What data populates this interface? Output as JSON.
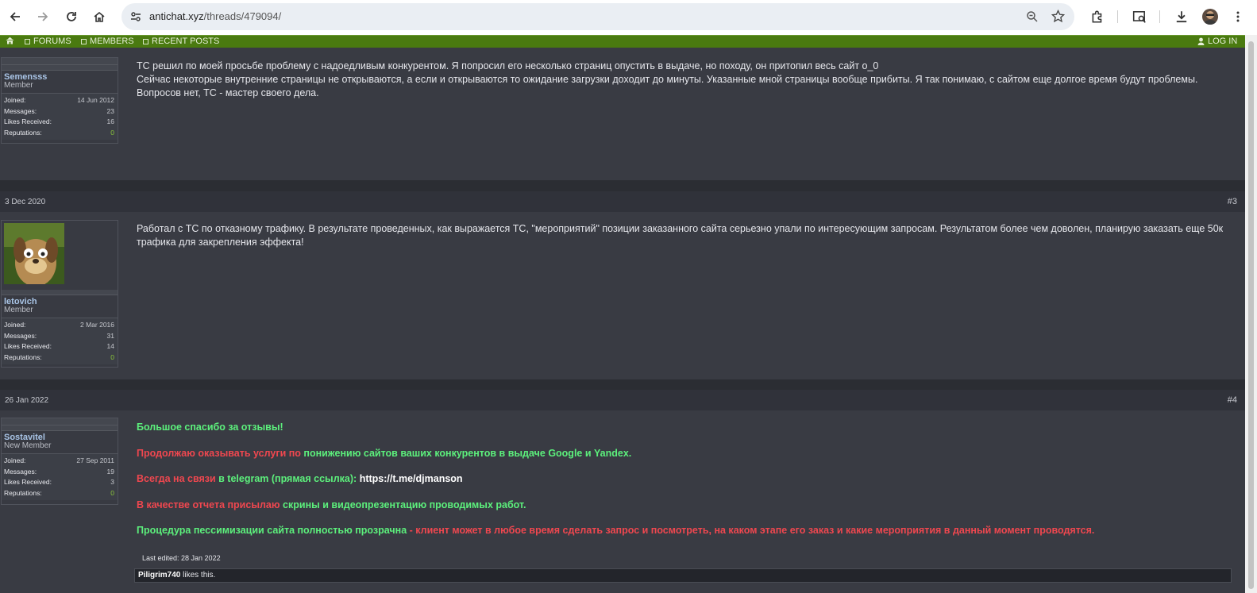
{
  "browser": {
    "url_host": "antichat.xyz",
    "url_path": "/threads/479094/"
  },
  "nav": {
    "forums": "FORUMS",
    "members": "MEMBERS",
    "recent_posts": "RECENT POSTS",
    "login": "LOG IN"
  },
  "posts": [
    {
      "username": "Semensss",
      "user_title": "Member",
      "joined_label": "Joined:",
      "joined": "14 Jun 2012",
      "messages_label": "Messages:",
      "messages": "23",
      "likes_label": "Likes Received:",
      "likes": "16",
      "rep_label": "Reputations:",
      "rep": "0",
      "lines": [
        "ТС решил по моей просьбе проблему с надоедливым конкурентом. Я попросил его несколько страниц опустить в выдаче, но походу, он притопил весь сайт о_0",
        "Сейчас некоторые внутренние страницы не открываются, а если и открываются то ожидание загрузки доходит до минуты. Указанные мной страницы вообще прибиты. Я так понимаю, с сайтом еще долгое время будут проблемы. Вопросов нет, ТС - мастер своего дела."
      ]
    },
    {
      "date": "3 Dec 2020",
      "number": "#3",
      "username": "letovich",
      "user_title": "Member",
      "joined_label": "Joined:",
      "joined": "2 Mar 2016",
      "messages_label": "Messages:",
      "messages": "31",
      "likes_label": "Likes Received:",
      "likes": "14",
      "rep_label": "Reputations:",
      "rep": "0",
      "text": "Работал с ТС по отказному трафику. В результате проведенных, как выражается ТС, \"мероприятий\" позиции заказанного сайта серьезно упали по интересующим запросам. Результатом более чем доволен, планирую заказать еще 50к трафика для закрепления эффекта!"
    },
    {
      "date": "26 Jan 2022",
      "number": "#4",
      "username": "Sostavitel",
      "user_title": "New Member",
      "joined_label": "Joined:",
      "joined": "27 Sep 2011",
      "messages_label": "Messages:",
      "messages": "19",
      "likes_label": "Likes Received:",
      "likes": "3",
      "rep_label": "Reputations:",
      "rep": "0",
      "p1": "Большое спасибо за отзывы!",
      "p2a": "Продолжаю оказывать услуги по ",
      "p2b": "понижению сайтов ваших конкурентов в выдаче Google и Yandex.",
      "p3a": "Всегда на связи ",
      "p3b": "в telegram (прямая ссылка): ",
      "p3c": "https://t.me/djmanson",
      "p4a": "В качестве отчета присылаю ",
      "p4b": "скрины и видеопрезентацию проводимых работ.",
      "p5a": "Процедура пессимизации сайта полностью прозрачна",
      "p5b": " - клиент может в любое время сделать запрос и посмотреть, на каком этапе его заказ и какие мероприятия в данный момент проводятся.",
      "edited": "Last edited: 28 Jan 2022",
      "liker": "Piligrim740",
      "likes_text": " likes this."
    }
  ],
  "colors": {
    "accent_green": "#5cf07c",
    "accent_red": "#f0474f",
    "navbar": "#4a7a10"
  }
}
